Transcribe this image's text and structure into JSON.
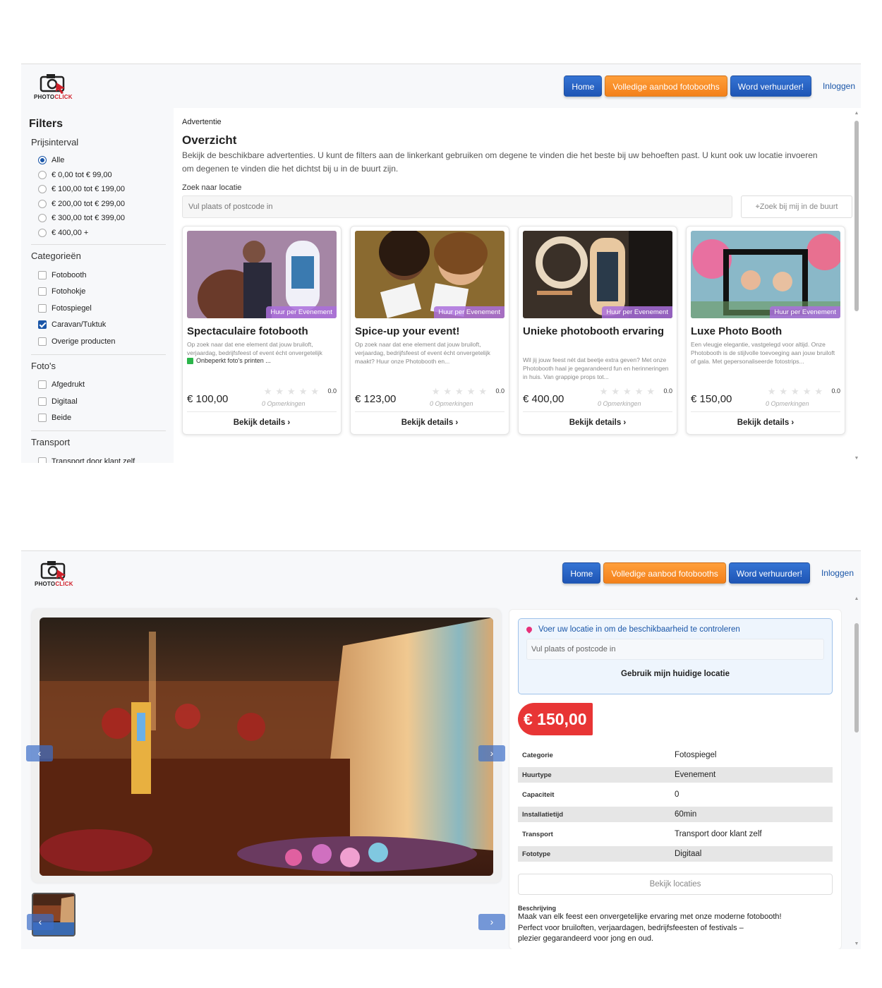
{
  "brand": {
    "name_a": "PHOTO",
    "name_b": "CLICK",
    "accent": "#d0202a"
  },
  "nav": {
    "home": "Home",
    "offer": "Volledige aanbod fotobooths",
    "rent": "Word verhuurder!",
    "login": "Inloggen"
  },
  "filters": {
    "title": "Filters",
    "price_title": "Prijsinterval",
    "price_options": [
      "Alle",
      "€ 0,00 tot € 99,00",
      "€ 100,00 tot € 199,00",
      "€ 200,00 tot € 299,00",
      "€ 300,00 tot € 399,00",
      "€ 400,00 +"
    ],
    "price_selected": 0,
    "cat_title": "Categorieën",
    "categories": [
      "Fotobooth",
      "Fotohokje",
      "Fotospiegel",
      "Caravan/Tuktuk",
      "Overige producten"
    ],
    "categories_checked": [
      false,
      false,
      false,
      true,
      false
    ],
    "photo_title": "Foto's",
    "photos": [
      "Afgedrukt",
      "Digitaal",
      "Beide"
    ],
    "transport_title": "Transport",
    "transport": [
      "Transport door klant zelf"
    ]
  },
  "main": {
    "crumb": "Advertentie",
    "title": "Overzicht",
    "desc": "Bekijk de beschikbare advertenties. U kunt de filters aan de linkerkant gebruiken om degene te vinden die het beste bij uw behoeften past. U kunt ook uw locatie invoeren om degenen te vinden die het dichtst bij u in de buurt zijn.",
    "search_label": "Zoek naar locatie",
    "search_placeholder": "Vul plaats of postcode in",
    "near_button": "Zoek bij mij in de buurt"
  },
  "cards": [
    {
      "badge": "Huur per Evenement",
      "title": "Spectaculaire fotobooth",
      "desc": "Op zoek naar dat ene element dat jouw bruiloft, verjaardag, bedrijfsfeest of event écht onvergetelijk maakt? Huur onze Photobooth en creëer spontane momenten.",
      "feature": "Onbeperkt foto's printen ...",
      "price": "€ 100,00",
      "rating": "0.0",
      "reviews": "0 Opmerkingen",
      "details": "Bekijk details"
    },
    {
      "badge": "Huur per Evenement",
      "title": "Spice-up your event!",
      "desc": "Op zoek naar dat ene element dat jouw bruiloft, verjaardag, bedrijfsfeest of event écht onvergetelijk maakt? Huur onze Photobooth en...",
      "feature": "",
      "price": "€ 123,00",
      "rating": "0.0",
      "reviews": "0 Opmerkingen",
      "details": "Bekijk details"
    },
    {
      "badge": "Huur per Evenement",
      "title": "Unieke photobooth ervaring",
      "desc": "Wil jij jouw feest nét dat beetje extra geven? Met onze Photobooth haal je gegarandeerd fun en herinneringen in huis. Van grappige props tot...",
      "feature": "",
      "price": "€ 400,00",
      "rating": "0.0",
      "reviews": "0 Opmerkingen",
      "details": "Bekijk details"
    },
    {
      "badge": "Huur per Evenement",
      "title": "Luxe Photo Booth",
      "desc": "Een vleugje elegantie, vastgelegd voor altijd. Onze Photobooth is de stijlvolle toevoeging aan jouw bruiloft of gala. Met gepersonaliseerde fotostrips...",
      "feature": "",
      "price": "€ 150,00",
      "rating": "0.0",
      "reviews": "0 Opmerkingen",
      "details": "Bekijk details"
    }
  ],
  "detail": {
    "loc_title": "Voer uw locatie in om de beschikbaarheid te controleren",
    "loc_placeholder": "Vul plaats of postcode in",
    "loc_button": "Gebruik mijn huidige locatie",
    "price": "€ 150,00",
    "specs": [
      {
        "k": "Categorie",
        "v": "Fotospiegel"
      },
      {
        "k": "Huurtype",
        "v": "Evenement"
      },
      {
        "k": "Capaciteit",
        "v": "0"
      },
      {
        "k": "Installatietijd",
        "v": "60min"
      },
      {
        "k": "Transport",
        "v": "Transport door klant zelf"
      },
      {
        "k": "Fototype",
        "v": "Digitaal"
      }
    ],
    "locations_button": "Bekijk locaties",
    "desc_title": "Beschrijving",
    "desc": "Maak van elk feest een onvergetelijke ervaring met onze moderne fotobooth!\n Perfect voor bruiloften, verjaardagen, bedrijfsfeesten of festivals –\n plezier gegarandeerd voor jong en oud."
  },
  "icons": [
    "camera-logo-icon",
    "chevron-left-icon",
    "chevron-right-icon",
    "location-pin-icon",
    "star-icon",
    "check-icon"
  ]
}
